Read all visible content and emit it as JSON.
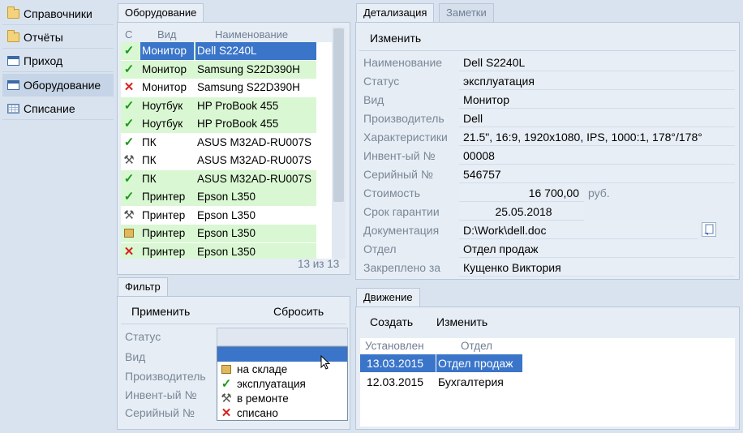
{
  "nav": {
    "items": [
      {
        "label": "Справочники",
        "icon": "folder-icon"
      },
      {
        "label": "Отчёты",
        "icon": "folder-icon"
      },
      {
        "label": "Приход",
        "icon": "window-icon"
      },
      {
        "label": "Оборудование",
        "icon": "window-icon"
      },
      {
        "label": "Списание",
        "icon": "grid-icon"
      }
    ],
    "active_index": 3
  },
  "equipment": {
    "tab": "Оборудование",
    "columns": {
      "status": "С",
      "kind": "Вид",
      "name": "Наименование"
    },
    "rows": [
      {
        "status": "check",
        "kind": "Монитор",
        "name": "Dell S2240L",
        "bg": "green",
        "selected": true
      },
      {
        "status": "check",
        "kind": "Монитор",
        "name": "Samsung S22D390H",
        "bg": "green"
      },
      {
        "status": "cross",
        "kind": "Монитор",
        "name": "Samsung S22D390H",
        "bg": "white"
      },
      {
        "status": "check",
        "kind": "Ноутбук",
        "name": "HP ProBook 455",
        "bg": "green"
      },
      {
        "status": "check",
        "kind": "Ноутбук",
        "name": "HP ProBook 455",
        "bg": "green"
      },
      {
        "status": "check",
        "kind": "ПК",
        "name": "ASUS M32AD-RU007S",
        "bg": "white"
      },
      {
        "status": "wrench",
        "kind": "ПК",
        "name": "ASUS M32AD-RU007S",
        "bg": "white"
      },
      {
        "status": "check",
        "kind": "ПК",
        "name": "ASUS M32AD-RU007S",
        "bg": "green"
      },
      {
        "status": "check",
        "kind": "Принтер",
        "name": "Epson L350",
        "bg": "green"
      },
      {
        "status": "wrench",
        "kind": "Принтер",
        "name": "Epson L350",
        "bg": "white"
      },
      {
        "status": "box",
        "kind": "Принтер",
        "name": "Epson L350",
        "bg": "green"
      },
      {
        "status": "cross",
        "kind": "Принтер",
        "name": "Epson L350",
        "bg": "green"
      }
    ],
    "counter": "13 из 13"
  },
  "detail": {
    "tabs": [
      "Детализация",
      "Заметки"
    ],
    "edit_label": "Изменить",
    "fields": [
      {
        "label": "Наименование",
        "value": "Dell S2240L"
      },
      {
        "label": "Статус",
        "value": "эксплуатация"
      },
      {
        "label": "Вид",
        "value": "Монитор"
      },
      {
        "label": "Производитель",
        "value": "Dell"
      },
      {
        "label": "Характеристики",
        "value": "21.5\", 16:9, 1920x1080, IPS, 1000:1, 178°/178°"
      },
      {
        "label": "Инвент-ый №",
        "value": "00008"
      },
      {
        "label": "Серийный №",
        "value": "546757"
      },
      {
        "label": "Стоимость",
        "value": "16 700,00"
      },
      {
        "label": "Срок гарантии",
        "value": "25.05.2018"
      },
      {
        "label": "Документация",
        "value": "D:\\Work\\dell.doc"
      },
      {
        "label": "Отдел",
        "value": "Отдел продаж"
      },
      {
        "label": "Закреплено за",
        "value": "Кущенко Виктория"
      }
    ],
    "currency": "руб."
  },
  "filter": {
    "tab": "Фильтр",
    "apply_label": "Применить",
    "reset_label": "Сбросить",
    "labels": [
      "Статус",
      "Вид",
      "Производитель",
      "Инвент-ый №",
      "Серийный №"
    ],
    "status_options": [
      {
        "label": "на складе",
        "icon": "box"
      },
      {
        "label": "эксплуатация",
        "icon": "check"
      },
      {
        "label": "в ремонте",
        "icon": "wrench"
      },
      {
        "label": "списано",
        "icon": "cross"
      }
    ]
  },
  "movement": {
    "tab": "Движение",
    "create_label": "Создать",
    "edit_label": "Изменить",
    "columns": {
      "installed": "Установлен",
      "dept": "Отдел"
    },
    "rows": [
      {
        "installed": "13.03.2015",
        "dept": "Отдел продаж",
        "selected": true
      },
      {
        "installed": "12.03.2015",
        "dept": "Бухгалтерия"
      }
    ]
  },
  "colors": {
    "selection": "#3a75c9",
    "ok_row": "#d9f7d2",
    "background": "#d9e3ef"
  }
}
